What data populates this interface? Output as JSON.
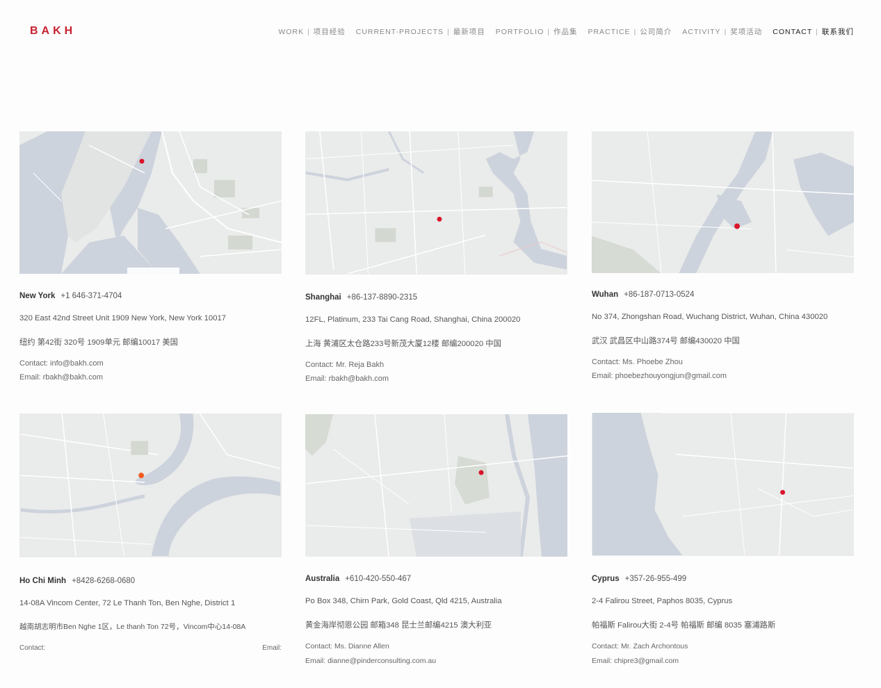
{
  "header": {
    "logo": "BAKH",
    "nav": [
      {
        "label": "WORK",
        "sep": "|",
        "cn": "项目经验"
      },
      {
        "label": "CURRENT-PROJECTS",
        "sep": "|",
        "cn": "最新项目"
      },
      {
        "label": "PORTFOLIO",
        "sep": "|",
        "cn": "作品集"
      },
      {
        "label": "PRACTICE",
        "sep": "|",
        "cn": "公司简介"
      },
      {
        "label": "ACTIVITY",
        "sep": "|",
        "cn": "奖项活动"
      },
      {
        "label": "CONTACT",
        "sep": "|",
        "cn": "联系我们"
      }
    ]
  },
  "offices": [
    {
      "city": "New York",
      "phone": "+1 646-371-4704",
      "address_en": "320 East 42nd Street Unit 1909 New York, New York 10017",
      "address_cn": "纽约 第42街 320号 1909单元  邮编10017 美国",
      "contact": "Contact: info@bakh.com",
      "email": "Email: rbakh@bakh.com"
    },
    {
      "city": "Shanghai",
      "phone": "+86-137-8890-2315",
      "address_en": "12FL, Platinum, 233 Tai Cang Road, Shanghai, China 200020",
      "address_cn": "上海 黄浦区太仓路233号新茂大厦12楼 邮编200020 中国",
      "contact": "Contact: Mr. Reja Bakh",
      "email": "Email: rbakh@bakh.com"
    },
    {
      "city": "Wuhan",
      "phone": "+86-187-0713-0524",
      "address_en": "No 374, Zhongshan Road, Wuchang District,     Wuhan, China 430020",
      "address_cn": "武汉 武昌区中山路374号 邮编430020 中国",
      "contact": "Contact: Ms. Phoebe Zhou",
      "email": "Email: phoebezhouyongjun@gmail.com"
    },
    {
      "city": "Ho Chi Minh",
      "phone": "+8428-6268-0680",
      "address_en": "14-08A Vincom Center, 72 Le Thanh Ton, Ben Nghe, District 1",
      "address_cn": "越南胡志明市Ben Nghe 1区，Le thanh Ton 72号，Vincom中心14-08A",
      "contact": "Contact:",
      "email": "Email:"
    },
    {
      "city": "Australia",
      "phone": "+610-420-550-467",
      "address_en": "Po Box 348, Chirn Park, Gold Coast, Qld 4215, Australia",
      "address_cn": "黄金海岸彻恩公园 邮箱348  昆士兰邮编4215  澳大利亚",
      "contact": "Contact: Ms. Dianne Allen",
      "email": "Email: dianne@pinderconsulting.com.au"
    },
    {
      "city": "Cyprus",
      "phone": "+357-26-955-499",
      "address_en": "2-4 Falirou Street, Paphos 8035, Cyprus",
      "address_cn": "帕福斯 Falirou大街 2-4号 帕福斯 邮编 8035 塞浦路斯",
      "contact": "Contact: Mr. Zach Archontous",
      "email": "Email: chipre3@gmail.com"
    }
  ],
  "colors": {
    "brand": "#c8202f",
    "map_land": "#e9eaea",
    "map_water": "#c9d0da",
    "map_park": "#d6dbd3",
    "marker": "#d9142b",
    "marker_orange": "#f05a1e"
  }
}
